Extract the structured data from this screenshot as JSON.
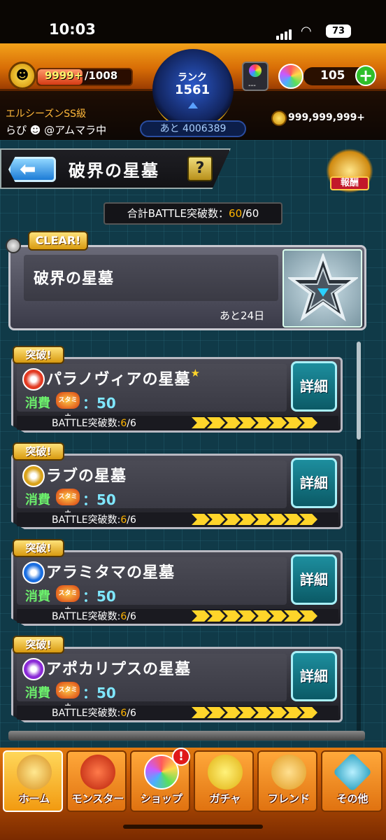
{
  "status_bar": {
    "time": "10:03",
    "battery": "73"
  },
  "hud": {
    "stamina_current": "9999+",
    "stamina_max": "/1008",
    "rank_label": "ランク",
    "rank_value": "1561",
    "exp_remaining": "あと 4006389",
    "orb_box_text": "---",
    "orbs": "105",
    "title": "エルシーズンSS級",
    "user": "らぴ ☻ @アムマラ中",
    "coins": "999,999,999+"
  },
  "header": {
    "title": "破界の星墓",
    "help": "?",
    "reward": "報酬"
  },
  "total_battle": {
    "label": "合計BATTLE突破数：",
    "value": "60",
    "max": "/60"
  },
  "event": {
    "badge": "CLEAR!",
    "name": "破界の星墓",
    "remaining": "あと24日"
  },
  "quests": [
    {
      "badge": "突破!",
      "name": "パラノヴィアの星墓",
      "star": "★",
      "element_color": "#e23a22",
      "cost_label": "消費",
      "stamina_label": "スタミナ",
      "cost": "：50",
      "detail": "詳細",
      "progress_label": "BATTLE突破数:",
      "progress": "6",
      "progress_max": "/6"
    },
    {
      "badge": "突破!",
      "name": "ラブの星墓",
      "star": "",
      "element_color": "#d8a21a",
      "cost_label": "消費",
      "stamina_label": "スタミナ",
      "cost": "：50",
      "detail": "詳細",
      "progress_label": "BATTLE突破数:",
      "progress": "6",
      "progress_max": "/6"
    },
    {
      "badge": "突破!",
      "name": "アラミタマの星墓",
      "star": "",
      "element_color": "#1a6ee0",
      "cost_label": "消費",
      "stamina_label": "スタミナ",
      "cost": "：50",
      "detail": "詳細",
      "progress_label": "BATTLE突破数:",
      "progress": "6",
      "progress_max": "/6"
    },
    {
      "badge": "突破!",
      "name": "アポカリプスの星墓",
      "star": "",
      "element_color": "#8a2ad6",
      "cost_label": "消費",
      "stamina_label": "スタミナ",
      "cost": "：50",
      "detail": "詳細",
      "progress_label": "BATTLE突破数:",
      "progress": "6",
      "progress_max": "/6"
    }
  ],
  "nav": [
    {
      "label": "ホーム",
      "icon": "home-icon"
    },
    {
      "label": "モンスター",
      "icon": "dragon-icon"
    },
    {
      "label": "ショップ",
      "icon": "orb-icon"
    },
    {
      "label": "ガチャ",
      "icon": "egg-icon"
    },
    {
      "label": "フレンド",
      "icon": "friends-icon"
    },
    {
      "label": "その他",
      "icon": "more-icon"
    }
  ],
  "shop_notification": "!"
}
